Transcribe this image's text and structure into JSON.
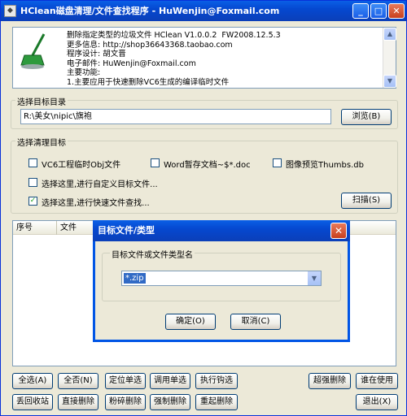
{
  "window": {
    "title": "HClean磁盘清理/文件查找程序 - HuWenjin@Foxmail.com",
    "min": "_",
    "max": "□",
    "close": "✕"
  },
  "info": {
    "text": "删除指定类型的垃圾文件 HClean V1.0.0.2  FW2008.12.5.3\n更多信息: http://shop36643368.taobao.com\n程序设计: 胡文晋\n电子邮件: HuWenjin@Foxmail.com\n主要功能:\n1.主要应用于快速删除VC6生成的编译临时文件",
    "scroll_up": "▲",
    "scroll_down": "▼"
  },
  "target_dir": {
    "label": "选择目标目录",
    "value": "R:\\美女\\nipic\\旗袍",
    "browse": "浏览(B)"
  },
  "clean": {
    "label": "选择清理目标",
    "opt1": "VC6工程临时Obj文件",
    "opt2": "Word暂存文档~$*.doc",
    "opt3": "图像预览Thumbs.db",
    "opt4": "选择这里,进行自定义目标文件...",
    "opt5": "选择这里,进行快速文件查找...",
    "scan": "扫描(S)",
    "checkmark": "✓"
  },
  "list": {
    "col1": "序号",
    "col2": "文件"
  },
  "buttons": {
    "select_all": "全选(A)",
    "select_none": "全否(N)",
    "locate_single": "定位单选",
    "invoke_single": "调用单选",
    "exec_checked": "执行钩选",
    "recycle": "丢回收站",
    "direct_delete": "直接删除",
    "shred": "粉碎删除",
    "force_delete": "强制删除",
    "reboot_delete": "重起删除",
    "super_delete": "超强删除",
    "who_uses": "谁在使用",
    "exit": "退出(X)"
  },
  "dialog": {
    "title": "目标文件/类型",
    "group": "目标文件或文件类型名",
    "value": "*.zip",
    "ok": "确定(O)",
    "cancel": "取消(C)",
    "close": "✕",
    "drop": "▼"
  }
}
